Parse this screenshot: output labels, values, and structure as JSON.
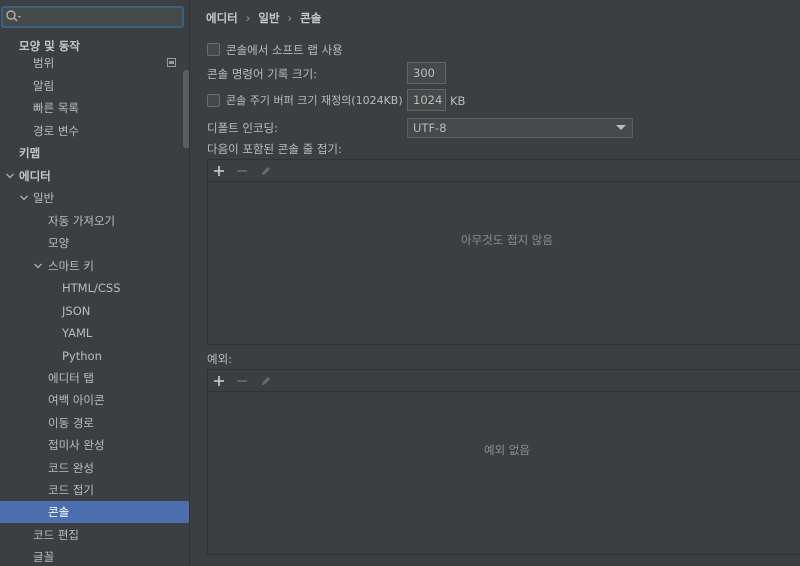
{
  "sidebar": {
    "search": {
      "value": "",
      "placeholder": ""
    },
    "items": [
      {
        "label": "모양 및 동작"
      },
      {
        "label": "범위"
      },
      {
        "label": "알림"
      },
      {
        "label": "빠른 목록"
      },
      {
        "label": "경로 변수"
      },
      {
        "label": "키맵"
      },
      {
        "label": "에디터"
      },
      {
        "label": "일반"
      },
      {
        "label": "자동 가져오기"
      },
      {
        "label": "모양"
      },
      {
        "label": "스마트 키"
      },
      {
        "label": "HTML/CSS"
      },
      {
        "label": "JSON"
      },
      {
        "label": "YAML"
      },
      {
        "label": "Python"
      },
      {
        "label": "에디터 탭"
      },
      {
        "label": "여백 아이콘"
      },
      {
        "label": "이동 경로"
      },
      {
        "label": "접미사 완성"
      },
      {
        "label": "코드 완성"
      },
      {
        "label": "코드 접기"
      },
      {
        "label": "콘솔"
      },
      {
        "label": "코드 편집"
      },
      {
        "label": "글꼴"
      }
    ]
  },
  "breadcrumb": [
    "에디터",
    "일반",
    "콘솔"
  ],
  "settings": {
    "soft_wrap_label": "콘솔에서 소프트 랩 사용",
    "history_label": "콘솔 명령어 기록 크기:",
    "history_value": "300",
    "cycle_buffer_label": "콘솔 주기 버퍼 크기 재정의(1024KB)",
    "cycle_buffer_value": "1024",
    "cycle_buffer_unit": "KB",
    "encoding_label": "디폴트 인코딩:",
    "encoding_value": "UTF-8",
    "fold_label": "다음이 포함된 콘솔 줄 접기:",
    "fold_empty": "아무것도 접지 않음",
    "exceptions_label": "예외:",
    "exceptions_empty": "예외 없음"
  },
  "colors": {
    "background": "#3c3f41",
    "selection": "#4b6eaf",
    "search_focus": "#3d6185"
  },
  "icons": {
    "search": "search-icon",
    "add": "plus-icon",
    "remove": "minus-icon",
    "edit": "pencil-icon"
  }
}
